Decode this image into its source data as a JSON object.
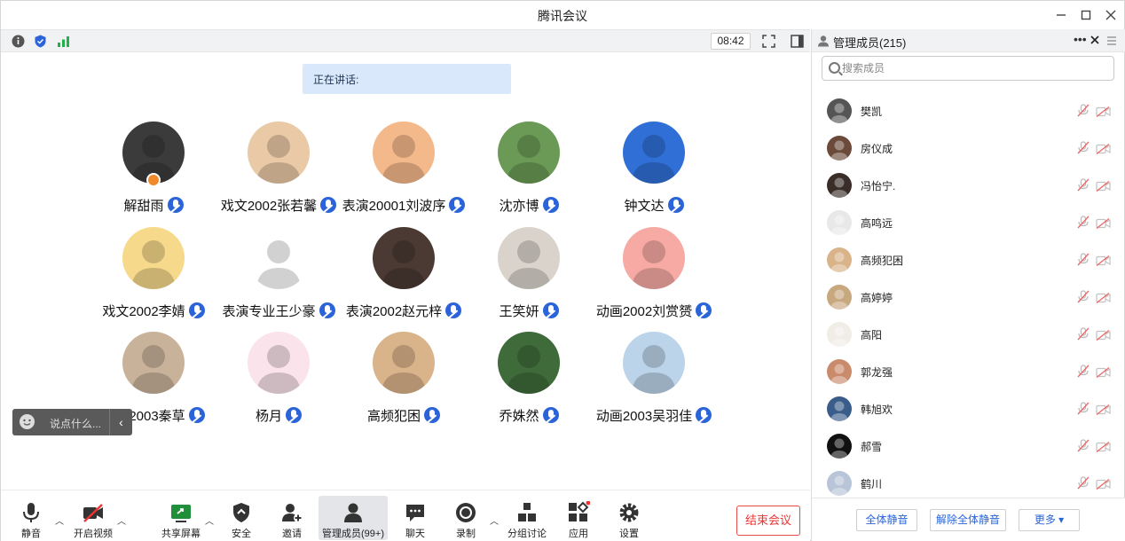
{
  "window": {
    "title": "腾讯会议",
    "minimize_icon": "minimize-icon",
    "maximize_icon": "maximize-icon",
    "close_icon": "close-icon"
  },
  "meeting_bar": {
    "time": "08:42",
    "status_icons": [
      "info-icon",
      "shield-icon",
      "signal-icon"
    ]
  },
  "stage": {
    "speaking_label": "正在讲话:",
    "participants": [
      {
        "name": "解甜雨",
        "host": true,
        "avatar": "#3b3b3b"
      },
      {
        "name": "戏文2002张若馨",
        "host": false,
        "avatar": "#e9c9a6"
      },
      {
        "name": "表演20001刘波序",
        "host": false,
        "avatar": "#f4b98b"
      },
      {
        "name": "沈亦博",
        "host": false,
        "avatar": "#6a9a55"
      },
      {
        "name": "钟文达",
        "host": false,
        "avatar": "#2f6fd6"
      },
      {
        "name": "戏文2002李婧",
        "host": false,
        "avatar": "#f6d98a"
      },
      {
        "name": "表演专业王少豪",
        "host": false,
        "avatar": "#ffffff"
      },
      {
        "name": "表演2002赵元梓",
        "host": false,
        "avatar": "#4a3a33"
      },
      {
        "name": "王笑妍",
        "host": false,
        "avatar": "#d9d3cc"
      },
      {
        "name": "动画2002刘赏赟",
        "host": false,
        "avatar": "#f7a9a4"
      },
      {
        "name": "动画2003秦草",
        "host": false,
        "avatar": "#c9b29a"
      },
      {
        "name": "杨月",
        "host": false,
        "avatar": "#fbe3ec"
      },
      {
        "name": "高频犯困",
        "host": false,
        "avatar": "#d9b389"
      },
      {
        "name": "乔姝然",
        "host": false,
        "avatar": "#3f6b3a"
      },
      {
        "name": "动画2003吴羽佳",
        "host": false,
        "avatar": "#bcd4ea"
      }
    ],
    "chat_placeholder": "说点什么...",
    "chat_collapse": "‹"
  },
  "toolbar": {
    "items": [
      {
        "label": "静音",
        "icon": "microphone-icon"
      },
      {
        "label": "开启视频",
        "icon": "video-off-icon"
      },
      {
        "label": "共享屏幕",
        "icon": "share-screen-icon"
      },
      {
        "label": "安全",
        "icon": "security-icon"
      },
      {
        "label": "邀请",
        "icon": "invite-icon"
      },
      {
        "label": "管理成员(99+)",
        "icon": "members-icon"
      },
      {
        "label": "聊天",
        "icon": "chat-icon"
      },
      {
        "label": "录制",
        "icon": "record-icon"
      },
      {
        "label": "分组讨论",
        "icon": "breakout-icon"
      },
      {
        "label": "应用",
        "icon": "apps-icon"
      },
      {
        "label": "设置",
        "icon": "settings-icon"
      }
    ],
    "end_label": "结束会议",
    "accent": "#2a64d8",
    "end_color": "#e33333"
  },
  "panel": {
    "title": "管理成员(215)",
    "search_placeholder": "搜索成员",
    "members": [
      {
        "name": "樊凯",
        "avatar": "#555555"
      },
      {
        "name": "房仪成",
        "avatar": "#6b4a3a"
      },
      {
        "name": "冯怡宁.",
        "avatar": "#3a2d28"
      },
      {
        "name": "高鸣远",
        "avatar": "#e8e8e8"
      },
      {
        "name": "高频犯困",
        "avatar": "#d9b389"
      },
      {
        "name": "高婷婷",
        "avatar": "#c8a87f"
      },
      {
        "name": "高阳",
        "avatar": "#f0ece6"
      },
      {
        "name": "郭龙强",
        "avatar": "#c98b6b"
      },
      {
        "name": "韩旭欢",
        "avatar": "#3a5c8a"
      },
      {
        "name": "郝雪",
        "avatar": "#111111"
      },
      {
        "name": "鹤川",
        "avatar": "#b8c4d8"
      }
    ],
    "footer": {
      "mute_all": "全体静音",
      "unmute_all": "解除全体静音",
      "more": "更多 ▾"
    }
  }
}
